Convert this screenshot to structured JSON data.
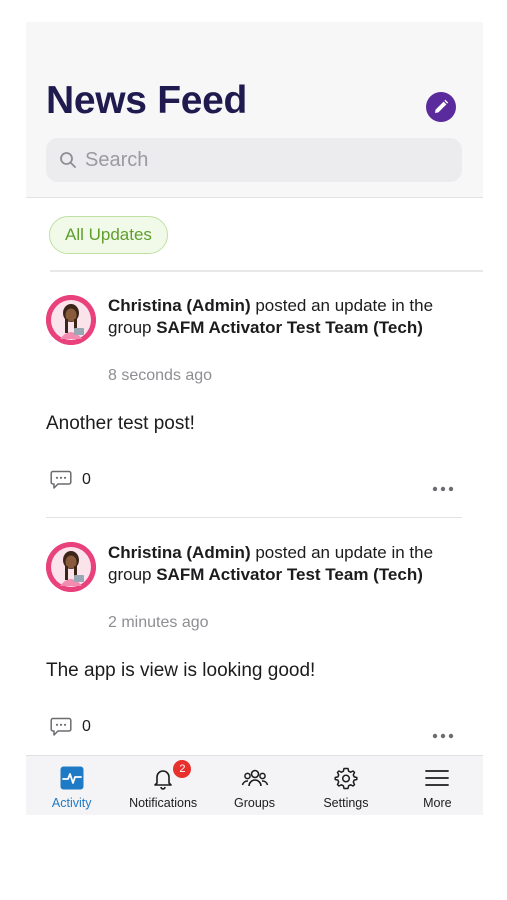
{
  "header": {
    "title": "News Feed",
    "compose_icon": "pencil-icon",
    "search_placeholder": "Search"
  },
  "filter": {
    "label": "All Updates"
  },
  "posts": [
    {
      "author": "Christina (Admin)",
      "action": " posted an update in the group ",
      "group": "SAFM Activator Test Team (Tech)",
      "time": "8 seconds ago",
      "text": "Another test post!",
      "comments": "0"
    },
    {
      "author": "Christina (Admin)",
      "action": " posted an update in the group ",
      "group": "SAFM Activator Test Team (Tech)",
      "time": "2 minutes ago",
      "text": "The app is view is looking good!",
      "comments": "0"
    }
  ],
  "tabbar": {
    "items": [
      {
        "label": "Activity",
        "icon": "activity-icon",
        "active": true
      },
      {
        "label": "Notifications",
        "icon": "bell-icon",
        "badge": "2"
      },
      {
        "label": "Groups",
        "icon": "groups-icon"
      },
      {
        "label": "Settings",
        "icon": "gear-icon"
      },
      {
        "label": "More",
        "icon": "menu-icon"
      }
    ]
  },
  "colors": {
    "title": "#1f1b4f",
    "accent_purple": "#5b2a9c",
    "filter_green": "#5e9f2d",
    "active_tab": "#1f7ac6",
    "badge": "#e8302c",
    "avatar_ring": "#e8417c"
  }
}
